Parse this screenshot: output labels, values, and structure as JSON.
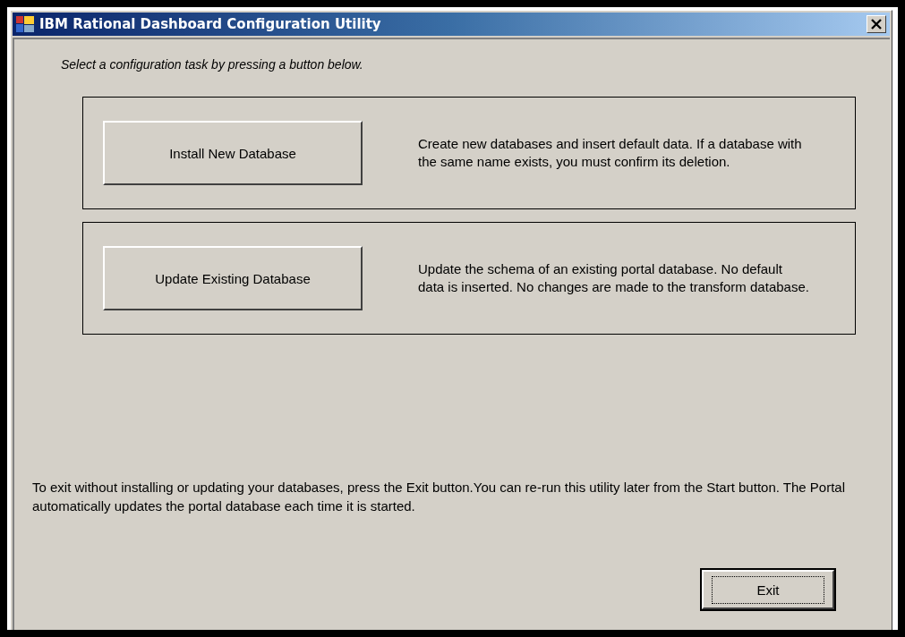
{
  "window": {
    "title": "IBM Rational Dashboard Configuration Utility"
  },
  "instruction": "Select a configuration task by pressing a button below.",
  "tasks": [
    {
      "button": "Install New Database",
      "description": "Create new databases and insert default data. If a database with the same name exists, you must confirm its deletion."
    },
    {
      "button": "Update Existing Database",
      "description": "Update the schema of an existing portal database. No default data is inserted. No changes are made to the transform database."
    }
  ],
  "note": "To exit without installing or updating your databases, press the Exit button.You can re-run this utility later from the Start button. The Portal automatically updates the portal database each time it is started.",
  "exit_button": {
    "label": "Exit",
    "focused": true
  }
}
